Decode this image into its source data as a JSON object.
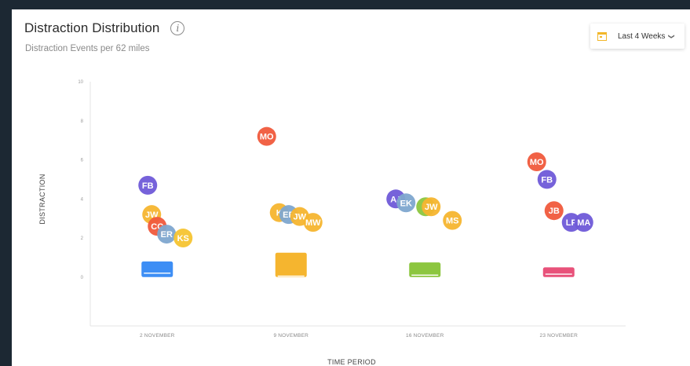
{
  "header": {
    "title": "Distraction Distribution",
    "info_glyph": "i",
    "subtitle": "Distraction Events per 62 miles"
  },
  "period_select": {
    "label": "Last 4 Weeks",
    "icon": "calendar-icon",
    "icon_color": "#f2b72a"
  },
  "chart_data": {
    "type": "scatter",
    "xlabel": "TIME PERIOD",
    "ylabel": "DISTRACTION",
    "ylim": [
      -2.5,
      10
    ],
    "yticks": [
      "10",
      "8",
      "6",
      "4",
      "2",
      "0"
    ],
    "ytick_values": [
      10,
      8,
      6,
      4,
      2,
      0
    ],
    "categories": [
      "2 NOVEMBER",
      "9 NOVEMBER",
      "16 NOVEMBER",
      "23 NOVEMBER"
    ],
    "boxes": [
      {
        "category": "2 NOVEMBER",
        "low": 0,
        "high": 0.8,
        "median": 0.2,
        "color": "#3d8ef5"
      },
      {
        "category": "9 NOVEMBER",
        "low": 0,
        "high": 1.25,
        "median": 0.05,
        "color": "#f5b52f"
      },
      {
        "category": "16 NOVEMBER",
        "low": 0,
        "high": 0.75,
        "median": 0.1,
        "color": "#8cc63f"
      },
      {
        "category": "23 NOVEMBER",
        "low": 0,
        "high": 0.5,
        "median": 0.15,
        "color": "#e8527a"
      }
    ],
    "points": [
      {
        "category": "2 NOVEMBER",
        "label": "FB",
        "y": 4.7,
        "offset": -12,
        "color": "#6f5ad8"
      },
      {
        "category": "2 NOVEMBER",
        "label": "JW",
        "y": 3.2,
        "offset": -7,
        "color": "#f5b52f"
      },
      {
        "category": "2 NOVEMBER",
        "label": "CC",
        "y": 2.6,
        "offset": 0,
        "color": "#f05a3c"
      },
      {
        "category": "2 NOVEMBER",
        "label": "ER",
        "y": 2.2,
        "offset": 12,
        "color": "#7ea6cf"
      },
      {
        "category": "2 NOVEMBER",
        "label": "KS",
        "y": 2.0,
        "offset": 33,
        "color": "#f5c431"
      },
      {
        "category": "9 NOVEMBER",
        "label": "MO",
        "y": 7.2,
        "offset": -31,
        "color": "#f05a3c"
      },
      {
        "category": "9 NOVEMBER",
        "label": "K",
        "y": 3.3,
        "offset": -15,
        "color": "#f5b52f"
      },
      {
        "category": "9 NOVEMBER",
        "label": "ER",
        "y": 3.2,
        "offset": -3,
        "color": "#7ea6cf"
      },
      {
        "category": "9 NOVEMBER",
        "label": "JW",
        "y": 3.1,
        "offset": 11,
        "color": "#f5b52f"
      },
      {
        "category": "9 NOVEMBER",
        "label": "MW",
        "y": 2.8,
        "offset": 28,
        "color": "#f5b52f"
      },
      {
        "category": "16 NOVEMBER",
        "label": "AJ",
        "y": 4.0,
        "offset": -37,
        "color": "#6f5ad8"
      },
      {
        "category": "16 NOVEMBER",
        "label": "EK",
        "y": 3.8,
        "offset": -24,
        "color": "#7ea6cf"
      },
      {
        "category": "16 NOVEMBER",
        "label": "E",
        "y": 3.6,
        "offset": 1,
        "color": "#8cc63f"
      },
      {
        "category": "16 NOVEMBER",
        "label": "JW",
        "y": 3.6,
        "offset": 8,
        "color": "#f5b52f"
      },
      {
        "category": "16 NOVEMBER",
        "label": "MS",
        "y": 2.9,
        "offset": 35,
        "color": "#f5b52f"
      },
      {
        "category": "23 NOVEMBER",
        "label": "MO",
        "y": 5.9,
        "offset": -28,
        "color": "#f05a3c"
      },
      {
        "category": "23 NOVEMBER",
        "label": "FB",
        "y": 5.0,
        "offset": -15,
        "color": "#6f5ad8"
      },
      {
        "category": "23 NOVEMBER",
        "label": "JB",
        "y": 3.4,
        "offset": -6,
        "color": "#f05a3c"
      },
      {
        "category": "23 NOVEMBER",
        "label": "LP",
        "y": 2.8,
        "offset": 16,
        "color": "#6f5ad8"
      },
      {
        "category": "23 NOVEMBER",
        "label": "MA",
        "y": 2.8,
        "offset": 32,
        "color": "#6f5ad8"
      }
    ]
  }
}
